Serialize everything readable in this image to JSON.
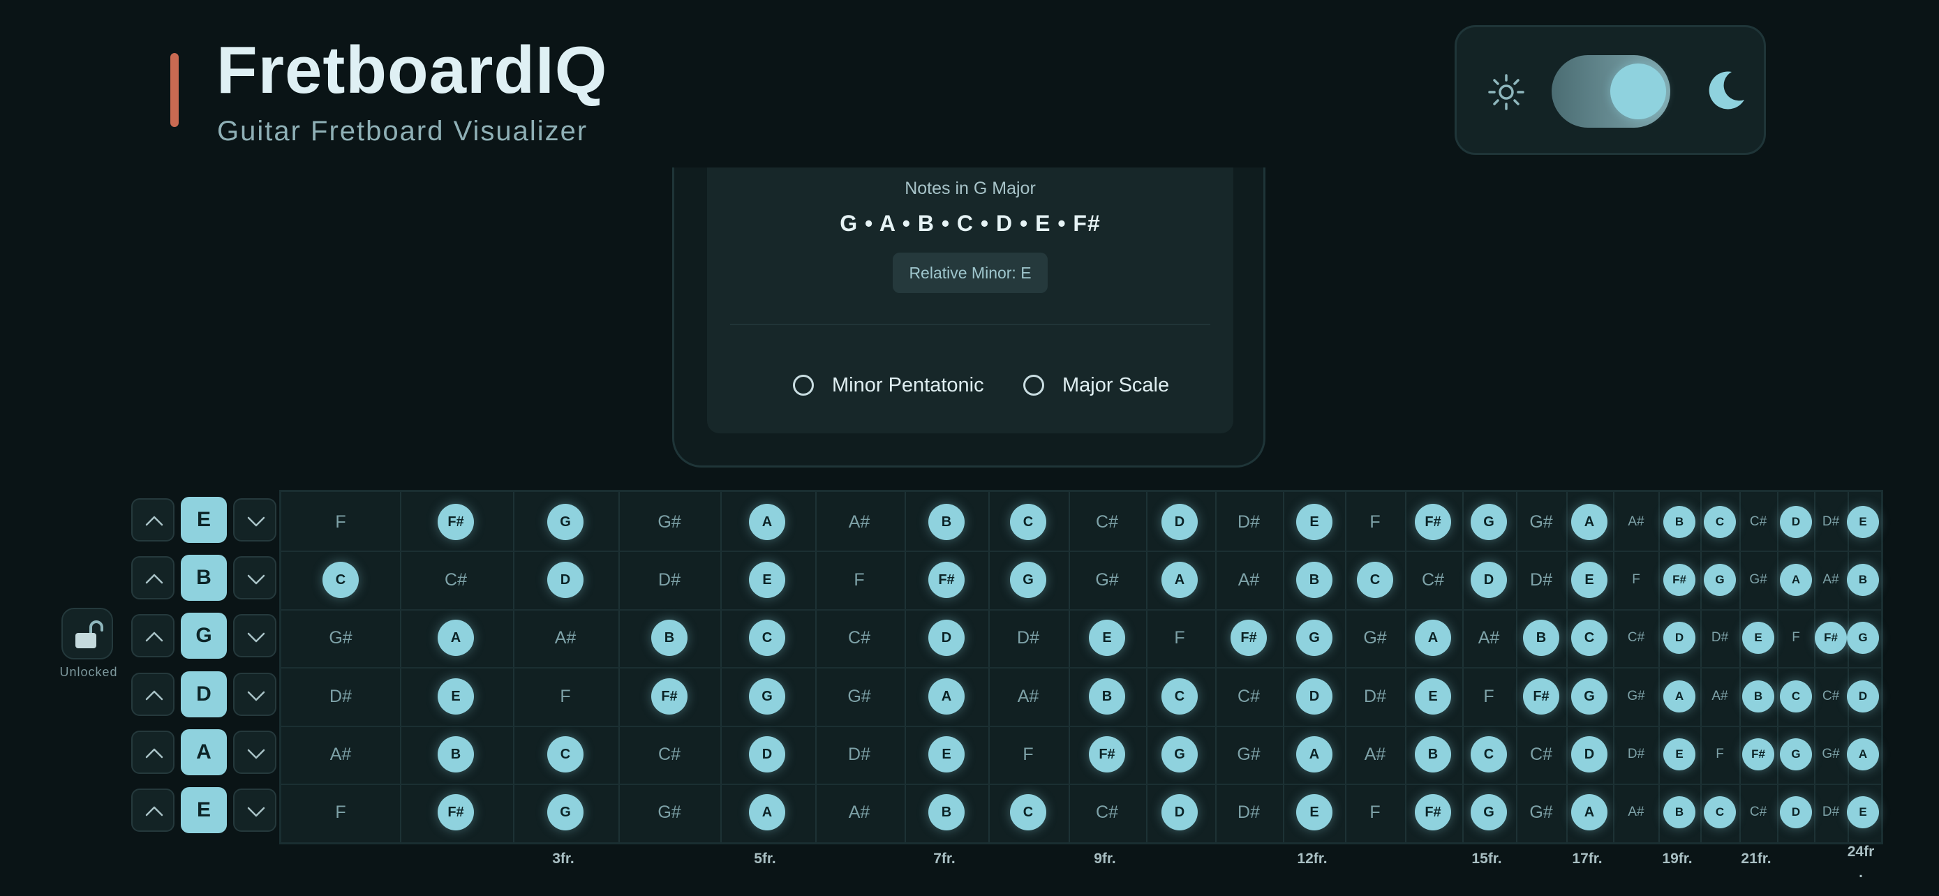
{
  "header": {
    "title": "FretboardIQ",
    "subtitle": "Guitar Fretboard Visualizer",
    "accent_color": "#c96a52"
  },
  "theme_toggle": {
    "light_icon": "sun-icon",
    "dark_icon": "moon-icon",
    "state": "dark"
  },
  "scale_card": {
    "notes_title": "Notes in G Major",
    "notes": "G • A • B • C • D • E • F#",
    "relative_minor": "Relative Minor: E",
    "options": [
      {
        "label": "Minor Pentatonic",
        "selected": false
      },
      {
        "label": "Major Scale",
        "selected": false
      }
    ]
  },
  "lock": {
    "label": "Unlocked",
    "icon": "unlock-icon"
  },
  "tuning": [
    "E",
    "B",
    "G",
    "D",
    "A",
    "E"
  ],
  "fretboard": {
    "rows": [
      [
        "F",
        "F#",
        "G",
        "G#",
        "A",
        "A#",
        "B",
        "C",
        "C#",
        "D",
        "D#",
        "E",
        "F",
        "F#",
        "G",
        "G#",
        "A",
        "A#",
        "B",
        "C",
        "C#",
        "D",
        "D#",
        "E"
      ],
      [
        "C",
        "C#",
        "D",
        "D#",
        "E",
        "F",
        "F#",
        "G",
        "G#",
        "A",
        "A#",
        "B",
        "C",
        "C#",
        "D",
        "D#",
        "E",
        "F",
        "F#",
        "G",
        "G#",
        "A",
        "A#",
        "B"
      ],
      [
        "G#",
        "A",
        "A#",
        "B",
        "C",
        "C#",
        "D",
        "D#",
        "E",
        "F",
        "F#",
        "G",
        "G#",
        "A",
        "A#",
        "B",
        "C",
        "C#",
        "D",
        "D#",
        "E",
        "F",
        "F#",
        "G"
      ],
      [
        "D#",
        "E",
        "F",
        "F#",
        "G",
        "G#",
        "A",
        "A#",
        "B",
        "C",
        "C#",
        "D",
        "D#",
        "E",
        "F",
        "F#",
        "G",
        "G#",
        "A",
        "A#",
        "B",
        "C",
        "C#",
        "D"
      ],
      [
        "A#",
        "B",
        "C",
        "C#",
        "D",
        "D#",
        "E",
        "F",
        "F#",
        "G",
        "G#",
        "A",
        "A#",
        "B",
        "C",
        "C#",
        "D",
        "D#",
        "E",
        "F",
        "F#",
        "G",
        "G#",
        "A"
      ],
      [
        "F",
        "F#",
        "G",
        "G#",
        "A",
        "A#",
        "B",
        "C",
        "C#",
        "D",
        "D#",
        "E",
        "F",
        "F#",
        "G",
        "G#",
        "A",
        "A#",
        "B",
        "C",
        "C#",
        "D",
        "D#",
        "E"
      ]
    ],
    "scale_notes": [
      "G",
      "A",
      "B",
      "C",
      "D",
      "E",
      "F#"
    ],
    "fret_markers": [
      {
        "fret": 3,
        "label": "3fr."
      },
      {
        "fret": 5,
        "label": "5fr."
      },
      {
        "fret": 7,
        "label": "7fr."
      },
      {
        "fret": 9,
        "label": "9fr."
      },
      {
        "fret": 12,
        "label": "12fr."
      },
      {
        "fret": 15,
        "label": "15fr."
      },
      {
        "fret": 17,
        "label": "17fr."
      },
      {
        "fret": 19,
        "label": "19fr."
      },
      {
        "fret": 21,
        "label": "21fr."
      },
      {
        "fret": 24,
        "label": "24fr\n."
      }
    ]
  },
  "colors": {
    "background": "#0a1416",
    "highlight": "#8fd2de",
    "panel": "#132325"
  }
}
